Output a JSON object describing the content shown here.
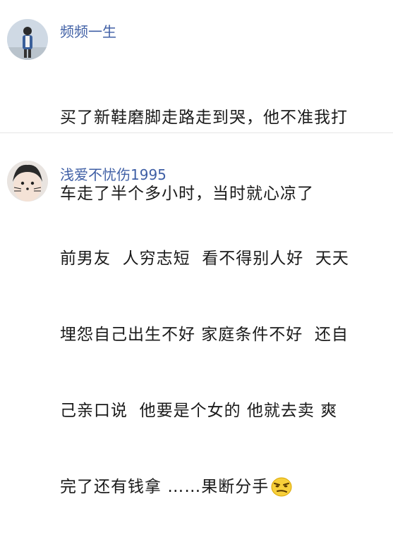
{
  "accent_color": "#3f5fa5",
  "comments": [
    {
      "username": "频频一生",
      "lines": [
        "买了新鞋磨脚走路走到哭，他不准我打",
        "车走了半个多小时，当时就心凉了"
      ],
      "avatar_icon": "person-photo-avatar"
    },
    {
      "username": "浅爱不忧伤1995",
      "lines": [
        "前男友  人穷志短  看不得别人好  天天",
        "埋怨自己出生不好 家庭条件不好  还自",
        "己亲口说  他要是个女的 他就去卖 爽",
        "完了还有钱拿 ……果断分手"
      ],
      "avatar_icon": "cat-face-filter-avatar",
      "trailing_emoji": "smirk-emoji-icon"
    }
  ]
}
